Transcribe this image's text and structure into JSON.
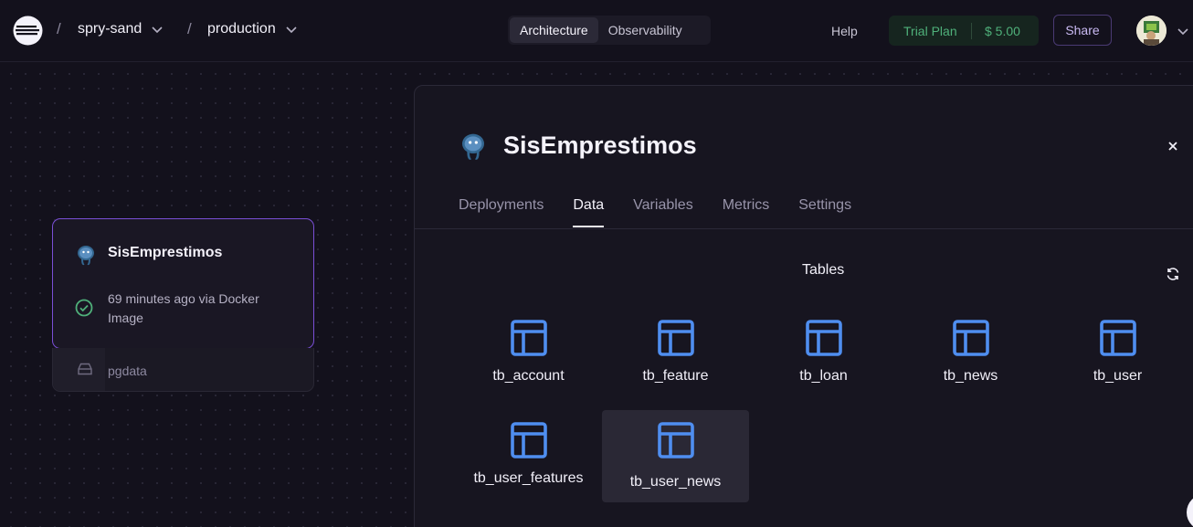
{
  "header": {
    "breadcrumb_sep": "/",
    "project": "spry-sand",
    "environment": "production",
    "view_tabs": [
      {
        "label": "Architecture",
        "active": true
      },
      {
        "label": "Observability",
        "active": false
      }
    ],
    "help": "Help",
    "trial_plan": "Trial Plan",
    "trial_credit": "$ 5.00",
    "share": "Share",
    "icons": [
      "logo-icon",
      "chevron-down-icon",
      "avatar"
    ]
  },
  "canvas": {
    "service": {
      "name": "SisEmprestimos",
      "status": "69 minutes ago via Docker Image",
      "icon": "postgres-icon"
    },
    "volume": {
      "name": "pgdata",
      "icon": "drive-icon"
    }
  },
  "panel": {
    "title": "SisEmprestimos",
    "tabs": [
      {
        "label": "Deployments",
        "active": false
      },
      {
        "label": "Data",
        "active": true
      },
      {
        "label": "Variables",
        "active": false
      },
      {
        "label": "Metrics",
        "active": false
      },
      {
        "label": "Settings",
        "active": false
      }
    ],
    "tables_heading": "Tables",
    "tables": [
      {
        "name": "tb_account",
        "selected": false
      },
      {
        "name": "tb_feature",
        "selected": false
      },
      {
        "name": "tb_loan",
        "selected": false
      },
      {
        "name": "tb_news",
        "selected": false
      },
      {
        "name": "tb_user",
        "selected": false
      },
      {
        "name": "tb_user_features",
        "selected": false
      },
      {
        "name": "tb_user_news",
        "selected": true
      }
    ]
  },
  "colors": {
    "background": "#13111c",
    "accent_purple": "#7a4fd6",
    "table_icon_blue": "#4f8ef0",
    "success_green": "#4fb07a"
  }
}
